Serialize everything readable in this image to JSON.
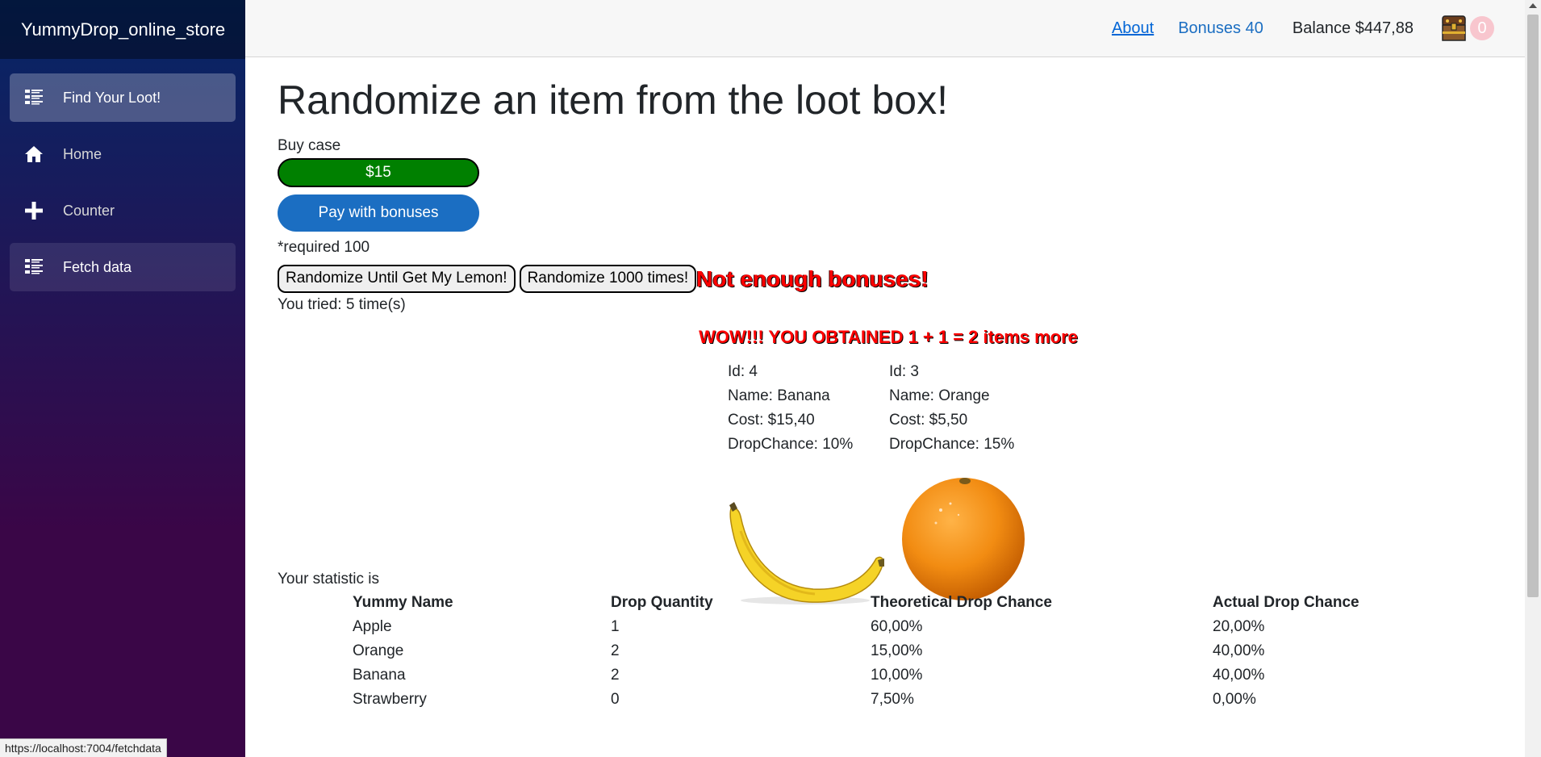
{
  "sidebar": {
    "brand": "YummyDrop_online_store",
    "items": [
      {
        "label": "Find Your Loot!",
        "icon": "list-rich-icon",
        "state": "active"
      },
      {
        "label": "Home",
        "icon": "home-icon",
        "state": ""
      },
      {
        "label": "Counter",
        "icon": "plus-icon",
        "state": ""
      },
      {
        "label": "Fetch data",
        "icon": "list-rich-icon",
        "state": "hover"
      }
    ]
  },
  "topbar": {
    "about": "About",
    "bonuses": "Bonuses 40",
    "balance": "Balance $447,88",
    "badge_count": "0"
  },
  "main": {
    "title": "Randomize an item from the loot box!",
    "buy_case_label": "Buy case",
    "buy_button": "$15",
    "bonus_button": "Pay with bonuses",
    "required_text": "*required 100",
    "randomize_lemon_button": "Randomize Until Get My Lemon!",
    "randomize_1000_button": "Randomize 1000 times!",
    "warning": "Not enough bonuses!",
    "tried_text": "You tried: 5 time(s)",
    "wow_text": "WOW!!! YOU OBTAINED 1 + 1 = 2 items more"
  },
  "items": [
    {
      "id": "Id: 4",
      "name": "Name: Banana",
      "cost": "Cost: $15,40",
      "chance": "DropChance: 10%",
      "image": "banana"
    },
    {
      "id": "Id: 3",
      "name": "Name: Orange",
      "cost": "Cost: $5,50",
      "chance": "DropChance: 15%",
      "image": "orange"
    }
  ],
  "stats": {
    "label": "Your statistic is",
    "headers": [
      "Yummy Name",
      "Drop Quantity",
      "Theoretical Drop Chance",
      "Actual Drop Chance"
    ],
    "rows": [
      [
        "Apple",
        "1",
        "60,00%",
        "20,00%"
      ],
      [
        "Orange",
        "2",
        "15,00%",
        "40,00%"
      ],
      [
        "Banana",
        "2",
        "10,00%",
        "40,00%"
      ],
      [
        "Strawberry",
        "0",
        "7,50%",
        "0,00%"
      ]
    ]
  },
  "status_bar_url": "https://localhost:7004/fetchdata",
  "colors": {
    "buy_green": "#008000",
    "bonus_blue": "#1b6ec2",
    "warning_red": "#ff0000",
    "badge_pink": "#f8c6ce"
  }
}
